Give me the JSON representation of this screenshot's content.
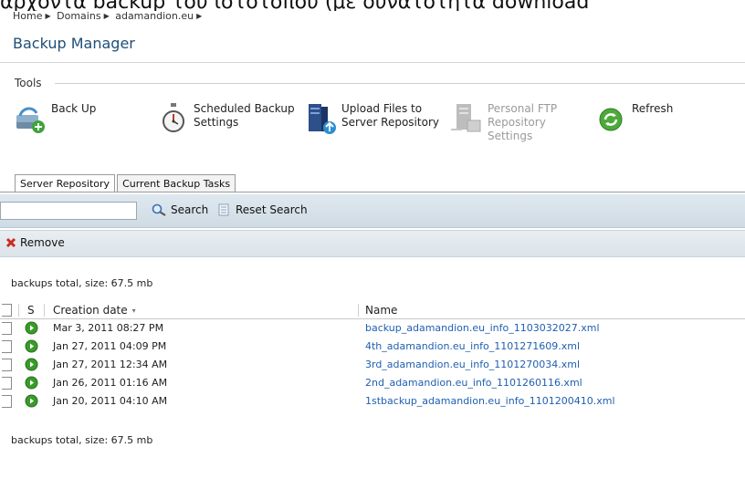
{
  "caption": "αρχοντα backup του ιστοτοπου (με δυνατοτητα download",
  "breadcrumb": [
    "Home",
    "Domains",
    "adamandion.eu"
  ],
  "page_title": "Backup Manager",
  "tools": {
    "heading": "Tools",
    "items": [
      {
        "label": "Back Up",
        "icon": "backup-icon",
        "enabled": true
      },
      {
        "label": "Scheduled Backup\nSettings",
        "icon": "stopwatch-icon",
        "enabled": true
      },
      {
        "label": "Upload Files to\nServer Repository",
        "icon": "upload-server-icon",
        "enabled": true
      },
      {
        "label": "Personal FTP\nRepository\nSettings",
        "icon": "ftp-repository-icon",
        "enabled": false
      },
      {
        "label": "Refresh",
        "icon": "refresh-icon",
        "enabled": true
      }
    ]
  },
  "tabs": [
    "Server Repository",
    "Current Backup Tasks"
  ],
  "search": {
    "value": "",
    "search_label": "Search",
    "reset_label": "Reset Search"
  },
  "remove_label": "Remove",
  "totals": {
    "top": "backups total, size: 67.5 mb",
    "bottom": "backups total, size: 67.5 mb"
  },
  "table": {
    "columns": {
      "status": "S",
      "date": "Creation date",
      "name": "Name"
    },
    "sort_indicator": "▾",
    "rows": [
      {
        "date": "Mar 3, 2011 08:27 PM",
        "name": "backup_adamandion.eu_info_1103032027.xml"
      },
      {
        "date": "Jan 27, 2011 04:09 PM",
        "name": "4th_adamandion.eu_info_1101271609.xml"
      },
      {
        "date": "Jan 27, 2011 12:34 AM",
        "name": "3rd_adamandion.eu_info_1101270034.xml"
      },
      {
        "date": "Jan 26, 2011 01:16 AM",
        "name": "2nd_adamandion.eu_info_1101260116.xml"
      },
      {
        "date": "Jan 20, 2011 04:10 AM",
        "name": "1stbackup_adamandion.eu_info_1101200410.xml"
      }
    ]
  },
  "colors": {
    "link": "#1f5fb0",
    "title": "#1f4e79",
    "status_ok": "#3a9b2a"
  }
}
